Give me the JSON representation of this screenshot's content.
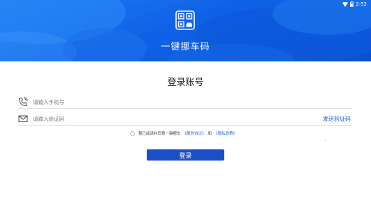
{
  "status_bar": {
    "time": "2:52"
  },
  "header": {
    "app_title": "一键挪车码"
  },
  "login": {
    "title": "登录账号",
    "phone": {
      "placeholder": "请输入手机号",
      "value": ""
    },
    "code": {
      "placeholder": "请输入验证码",
      "value": ""
    },
    "send_code_label": "发送验证码",
    "agreement": {
      "text": "我已阅读并同意一键挪车",
      "user_agreement": "《服务协议》",
      "conjunction": "和",
      "privacy_policy": "《隐私政策》"
    },
    "submit_label": "登录"
  },
  "icons": {
    "logo": "qr-car-icon",
    "phone": "phone-icon",
    "code": "envelope-icon",
    "wifi": "wifi-icon",
    "battery": "battery-icon"
  },
  "colors": {
    "banner": "#0f62e6",
    "accent": "#1b4fc7",
    "link": "#1a5cd6"
  }
}
